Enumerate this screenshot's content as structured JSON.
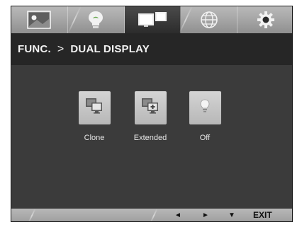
{
  "tabs": [
    {
      "name": "picture-icon",
      "active": false
    },
    {
      "name": "energy-bulb-icon",
      "active": false
    },
    {
      "name": "dual-display-icon",
      "active": true
    },
    {
      "name": "globe-icon",
      "active": false
    },
    {
      "name": "settings-gear-icon",
      "active": false
    }
  ],
  "header": {
    "section": "FUNC.",
    "separator": ">",
    "page": "DUAL DISPLAY"
  },
  "options": [
    {
      "label": "Clone",
      "icon": "clone-monitors-icon"
    },
    {
      "label": "Extended",
      "icon": "extended-monitors-icon"
    },
    {
      "label": "Off",
      "icon": "bulb-off-icon"
    }
  ],
  "nav": {
    "left": "◄",
    "right": "►",
    "down": "▼",
    "exit": "EXIT"
  },
  "colors": {
    "tab_bar": "#a3a3a3",
    "active_tab": "#333333",
    "header_bg": "#262626",
    "body_bg": "#3b3b3b",
    "tile": "#c6c6c6"
  }
}
